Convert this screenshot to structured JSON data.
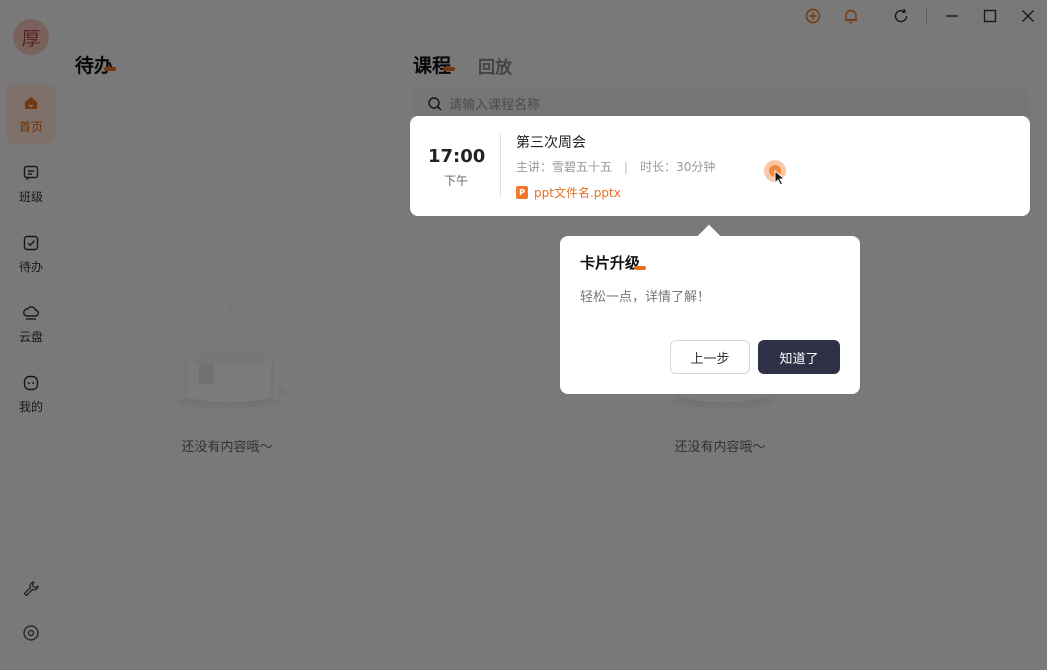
{
  "sidebar": {
    "avatar_text": "厚",
    "items": [
      {
        "label": "首页",
        "icon": "home-icon",
        "active": true
      },
      {
        "label": "班级",
        "icon": "class-icon",
        "active": false
      },
      {
        "label": "待办",
        "icon": "todo-icon",
        "active": false
      },
      {
        "label": "云盘",
        "icon": "cloud-disk-icon",
        "active": false
      },
      {
        "label": "我的",
        "icon": "profile-icon",
        "active": false
      }
    ],
    "bottom_icons": [
      "wrench-icon",
      "settings-icon"
    ]
  },
  "window_controls": [
    "add-icon",
    "bell-icon",
    "refresh-icon",
    "minimize-icon",
    "maximize-icon",
    "close-icon"
  ],
  "todo": {
    "title": "待办",
    "empty_text": "还没有内容哦～"
  },
  "course": {
    "tabs": [
      {
        "label": "课程",
        "active": true
      },
      {
        "label": "回放",
        "active": false
      }
    ],
    "search_placeholder": "请输入课程名称",
    "empty_text": "还没有内容哦～",
    "card": {
      "time": "17:00",
      "period": "下午",
      "name": "第三次周会",
      "presenter": "主讲：雪碧五十五",
      "separator": "|",
      "duration": "时长：30分钟",
      "file_name": "ppt文件名.pptx",
      "file_icon_letter": "P"
    }
  },
  "guide": {
    "title": "卡片升级",
    "description": "轻松一点，详情了解！",
    "prev_label": "上一步",
    "ok_label": "知道了"
  },
  "colors": {
    "accent": "#e8701f",
    "primary_button": "#2f3247",
    "overlay": "rgba(0,0,0,0.5)"
  }
}
